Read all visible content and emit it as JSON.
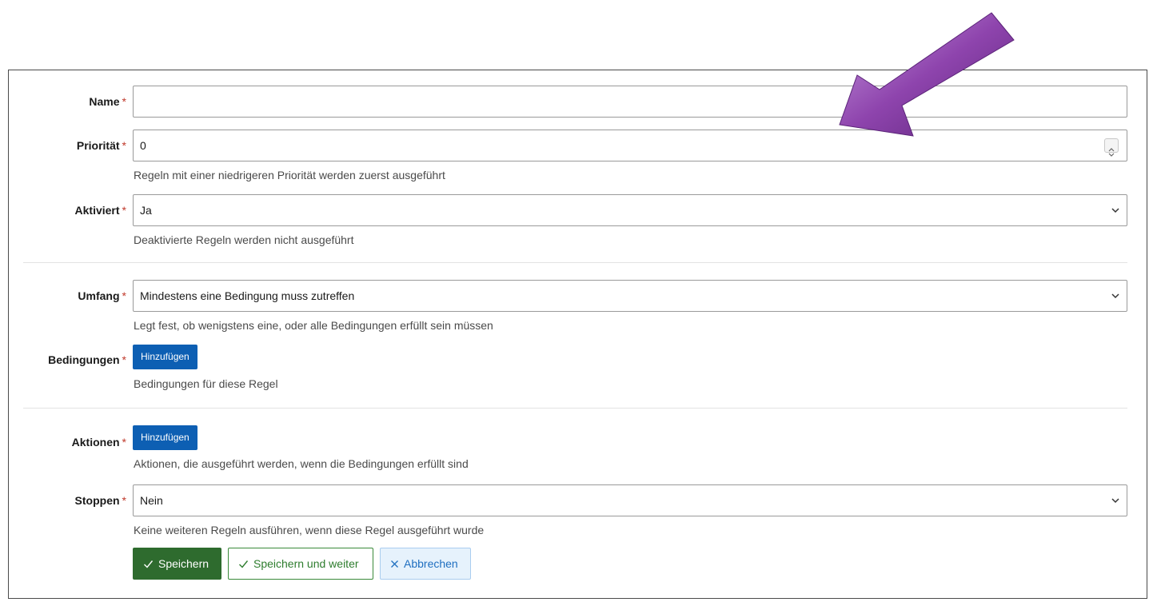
{
  "form": {
    "required_marker": "*",
    "name": {
      "label": "Name",
      "value": ""
    },
    "priority": {
      "label": "Priorität",
      "value": "0",
      "help": "Regeln mit einer niedrigeren Priorität werden zuerst ausgeführt"
    },
    "active": {
      "label": "Aktiviert",
      "value": "Ja",
      "help": "Deaktivierte Regeln werden nicht ausgeführt"
    },
    "scope": {
      "label": "Umfang",
      "value": "Mindestens eine Bedingung muss zutreffen",
      "help": "Legt fest, ob wenigstens eine, oder alle Bedingungen erfüllt sein müssen"
    },
    "conditions": {
      "label": "Bedingungen",
      "button": "Hinzufügen",
      "help": "Bedingungen für diese Regel"
    },
    "actions": {
      "label": "Aktionen",
      "button": "Hinzufügen",
      "help": "Aktionen, die ausgeführt werden, wenn die Bedingungen erfüllt sind"
    },
    "stop": {
      "label": "Stoppen",
      "value": "Nein",
      "help": "Keine weiteren Regeln ausführen, wenn diese Regel ausgeführt wurde"
    }
  },
  "buttons": {
    "save": "Speichern",
    "save_next": "Speichern und weiter",
    "cancel": "Abbrechen"
  },
  "icons": {
    "check": "check-icon",
    "close": "close-icon",
    "chevron": "chevron-down-icon",
    "annotation": "arrow-annotation"
  },
  "colors": {
    "primary_blue": "#0d5fb3",
    "save_green": "#2e6b2e",
    "cancel_bg": "#e6f2fc",
    "required_red": "#c0392b",
    "arrow_purple": "#8e44ad"
  }
}
